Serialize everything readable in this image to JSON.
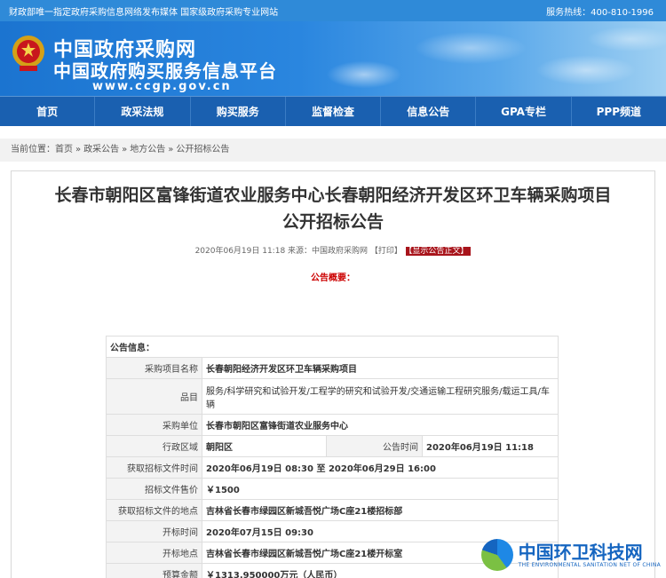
{
  "topbar": {
    "left": "财政部唯一指定政府采购信息网络发布媒体 国家级政府采购专业网站",
    "hotline": "服务热线：400-810-1996"
  },
  "banner": {
    "title": "中国政府采购网",
    "subtitle": "中国政府购买服务信息平台",
    "url": "www.ccgp.gov.cn"
  },
  "nav": [
    "首页",
    "政采法规",
    "购买服务",
    "监督检查",
    "信息公告",
    "GPA专栏",
    "PPP频道"
  ],
  "breadcrumb": {
    "prefix": "当前位置：",
    "items": [
      "首页",
      "政采公告",
      "地方公告",
      "公开招标公告"
    ]
  },
  "article": {
    "title": "长春市朝阳区富锋街道农业服务中心长春朝阳经济开发区环卫车辆采购项目公开招标公告",
    "meta": "2020年06月19日 11:18 来源：中国政府采购网 【打印】",
    "show_body": "【显示公告正文】",
    "summary": "公告概要："
  },
  "info_table": {
    "header": "公告信息：",
    "project_name_label": "采购项目名称",
    "project_name": "长春朝阳经济开发区环卫车辆采购项目",
    "category_label": "品目",
    "category": "服务/科学研究和试验开发/工程学的研究和试验开发/交通运输工程研究服务/载运工具/车辆",
    "buyer_label": "采购单位",
    "buyer": "长春市朝阳区富锋街道农业服务中心",
    "region_label": "行政区域",
    "region": "朝阳区",
    "pub_time_label": "公告时间",
    "pub_time": "2020年06月19日 11:18",
    "doc_time_label": "获取招标文件时间",
    "doc_time": "2020年06月19日 08:30 至 2020年06月29日 16:00",
    "doc_price_label": "招标文件售价",
    "doc_price": "￥1500",
    "doc_place_label": "获取招标文件的地点",
    "doc_place": "吉林省长春市绿园区新城吾悦广场C座21楼招标部",
    "open_time_label": "开标时间",
    "open_time": "2020年07月15日 09:30",
    "open_place_label": "开标地点",
    "open_place": "吉林省长春市绿园区新城吾悦广场C座21楼开标室",
    "budget_label": "预算金额",
    "budget": "￥1313.950000万元（人民币）"
  },
  "watermark": {
    "text": "中国环卫科技网",
    "en": "THE ENVIRONMENTAL SANITATION NET OF CHINA"
  },
  "colors": {
    "nav_bg": "#1a60b0",
    "banner": "#2a86df",
    "badge": "#a8141b"
  }
}
